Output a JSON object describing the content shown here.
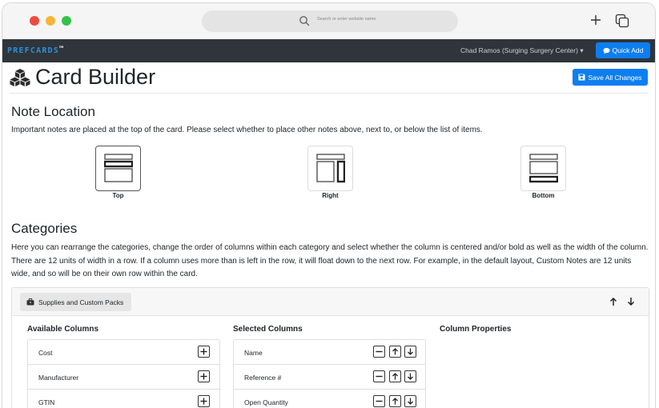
{
  "browser": {
    "url_placeholder": "Search or enter website name",
    "icons": [
      "search-icon",
      "plus-icon",
      "tabs-icon"
    ]
  },
  "navbar": {
    "brand": "PREFCARDS",
    "brand_tm": "™",
    "user": "Chad Ramos  (Surging Surgery Center)",
    "user_caret": "▾",
    "quick_add_label": "Quick Add",
    "accent_color": "#0d7ef0"
  },
  "header": {
    "title": "Card Builder",
    "save_label": "Save All Changes"
  },
  "note_location": {
    "heading": "Note Location",
    "description": "Important notes are placed at the top of the card. Please select whether to place other notes above, next to, or below the list of items.",
    "options": [
      {
        "label": "Top",
        "selected": true
      },
      {
        "label": "Right",
        "selected": false
      },
      {
        "label": "Bottom",
        "selected": false
      }
    ]
  },
  "categories": {
    "heading": "Categories",
    "description": "Here you can rearrange the categories, change the order of columns within each category and select whether the column is centered and/or bold as well as the width of the column. There are 12 units of width in a row. If a column uses more than is left in the row, it will float down to the next row. For example, in the default layout, Custom Notes are 12 units wide, and so will be on their own row within the card.",
    "category_name": "Supplies and Custom Packs",
    "available_title": "Available Columns",
    "selected_title": "Selected Columns",
    "properties_title": "Column Properties",
    "available_columns": [
      "Cost",
      "Manufacturer",
      "GTIN"
    ],
    "selected_columns": [
      "Name",
      "Reference #",
      "Open Quantity"
    ]
  }
}
